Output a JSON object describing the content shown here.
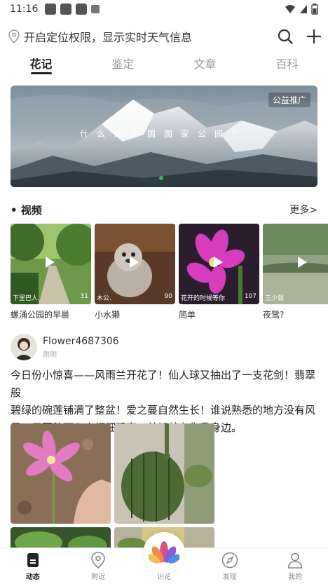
{
  "status_bar": {
    "time": "11:16"
  },
  "location": {
    "text": "开启定位权限，显示实时天气信息"
  },
  "tabs": [
    {
      "label": "花记",
      "active": true
    },
    {
      "label": "鉴定",
      "active": false
    },
    {
      "label": "文章",
      "active": false
    },
    {
      "label": "百科",
      "active": false
    }
  ],
  "banner": {
    "badge": "公益推广",
    "caption": "什么是中国国家公园？"
  },
  "videos": {
    "title": "• 视频",
    "more": "更多>",
    "items": [
      {
        "user": "下里巴人.",
        "count": "31",
        "title": "螺涌公园的早晨"
      },
      {
        "user": "木公.",
        "count": "90",
        "title": "小水獭"
      },
      {
        "user": "花开的时候等你",
        "count": "107",
        "title": "简单"
      },
      {
        "user": "三少翁",
        "count": "",
        "title": "夜鹭?"
      }
    ]
  },
  "post": {
    "username": "Flower4687306",
    "time": "刚刚",
    "lines": [
      "今日份小惊喜——风雨兰开花了！仙人球又抽出了一支花剑！翡翠般",
      "碧绿的碗莲铺满了整盆！爱之蔓自然生长！谁说熟悉的地方没有风",
      "景，只要静下心来细细观察，美好就在你我身边。"
    ]
  },
  "bottom_nav": [
    {
      "label": "动态",
      "icon": "feed-icon",
      "active": true
    },
    {
      "label": "附近",
      "icon": "location-pin-icon",
      "active": false
    },
    {
      "label": "识花",
      "icon": "lotus-icon",
      "active": false
    },
    {
      "label": "发现",
      "icon": "compass-icon",
      "active": false
    },
    {
      "label": "我的",
      "icon": "person-icon",
      "active": false
    }
  ],
  "colors": {
    "accent": "#3bb36b",
    "text": "#222222",
    "muted": "#999999"
  }
}
